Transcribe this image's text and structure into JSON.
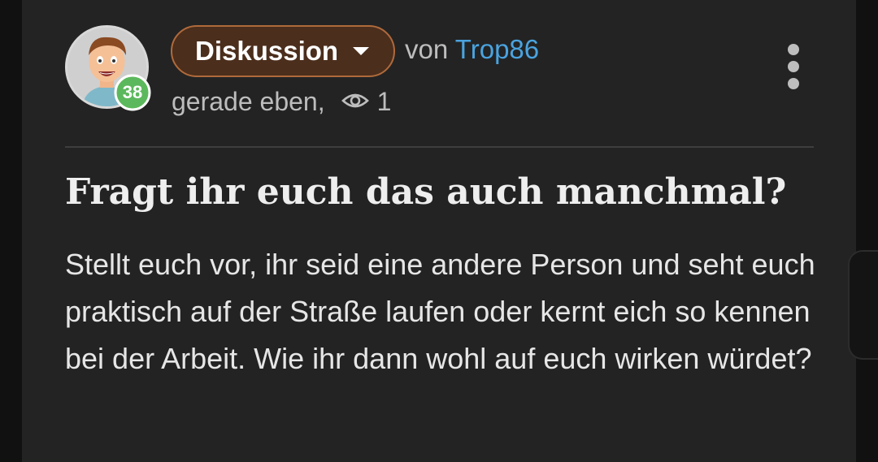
{
  "post": {
    "category_label": "Diskussion",
    "by_prefix": "von",
    "author": "Trop86",
    "level": "38",
    "time": "gerade eben,",
    "views": "1",
    "title": "Fragt ihr euch das auch manchmal?",
    "body": "Stellt euch vor, ihr seid eine andere Person und seht euch praktisch auf der Straße laufen oder kernt eich so kennen bei der Arbeit. Wie ihr dann wohl auf euch wirken würdet?"
  },
  "colors": {
    "background": "#232323",
    "pill_fill": "#4b2e1c",
    "pill_border": "#b06a3b",
    "author_link": "#4aa3df",
    "level_badge": "#5cb85c"
  },
  "icons": {
    "category_dropdown": "chevron-down-icon",
    "views": "eye-icon",
    "menu": "more-vertical-icon"
  }
}
